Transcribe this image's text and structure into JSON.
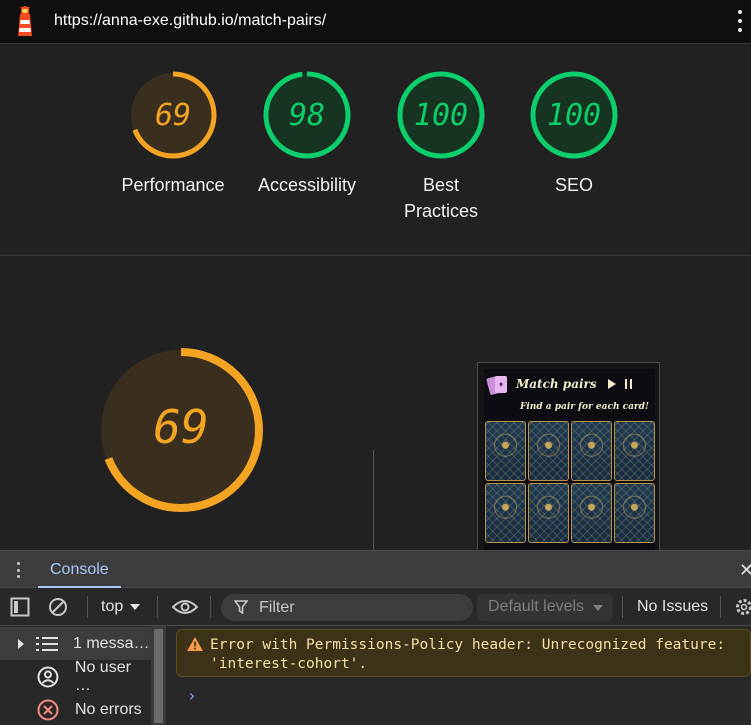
{
  "browser": {
    "url": "https://anna-exe.github.io/match-pairs/"
  },
  "scores": [
    {
      "value": "69",
      "label": "Performance",
      "level": 0.69,
      "color": "#f4a423"
    },
    {
      "value": "98",
      "label": "Accessibility",
      "level": 0.98,
      "color": "#0cce6b"
    },
    {
      "value": "100",
      "label": "Best Practices",
      "level": 1.0,
      "color": "#0cce6b"
    },
    {
      "value": "100",
      "label": "SEO",
      "level": 1.0,
      "color": "#0cce6b"
    }
  ],
  "main_score": {
    "value": "69",
    "level": 0.69,
    "color": "#f4a423"
  },
  "screenshot": {
    "title": "Match pairs",
    "subtitle": "Find a pair for each card!"
  },
  "devtools": {
    "tab": "Console",
    "context": "top",
    "filter_placeholder": "Filter",
    "levels": "Default levels",
    "issues": "No Issues",
    "sidebar": [
      {
        "label": "1 messa…",
        "icon": "list-icon"
      },
      {
        "label": "No user …",
        "icon": "user-icon"
      },
      {
        "label": "No errors",
        "icon": "error-circle-icon"
      }
    ],
    "messages": [
      {
        "type": "warning",
        "text": "Error with Permissions-Policy header: Unrecognized feature: 'interest-cohort'."
      }
    ],
    "prompt": "›"
  },
  "colors": {
    "pass": "#0cce6b",
    "average": "#f4a423",
    "accent": "#a8c7fa"
  }
}
